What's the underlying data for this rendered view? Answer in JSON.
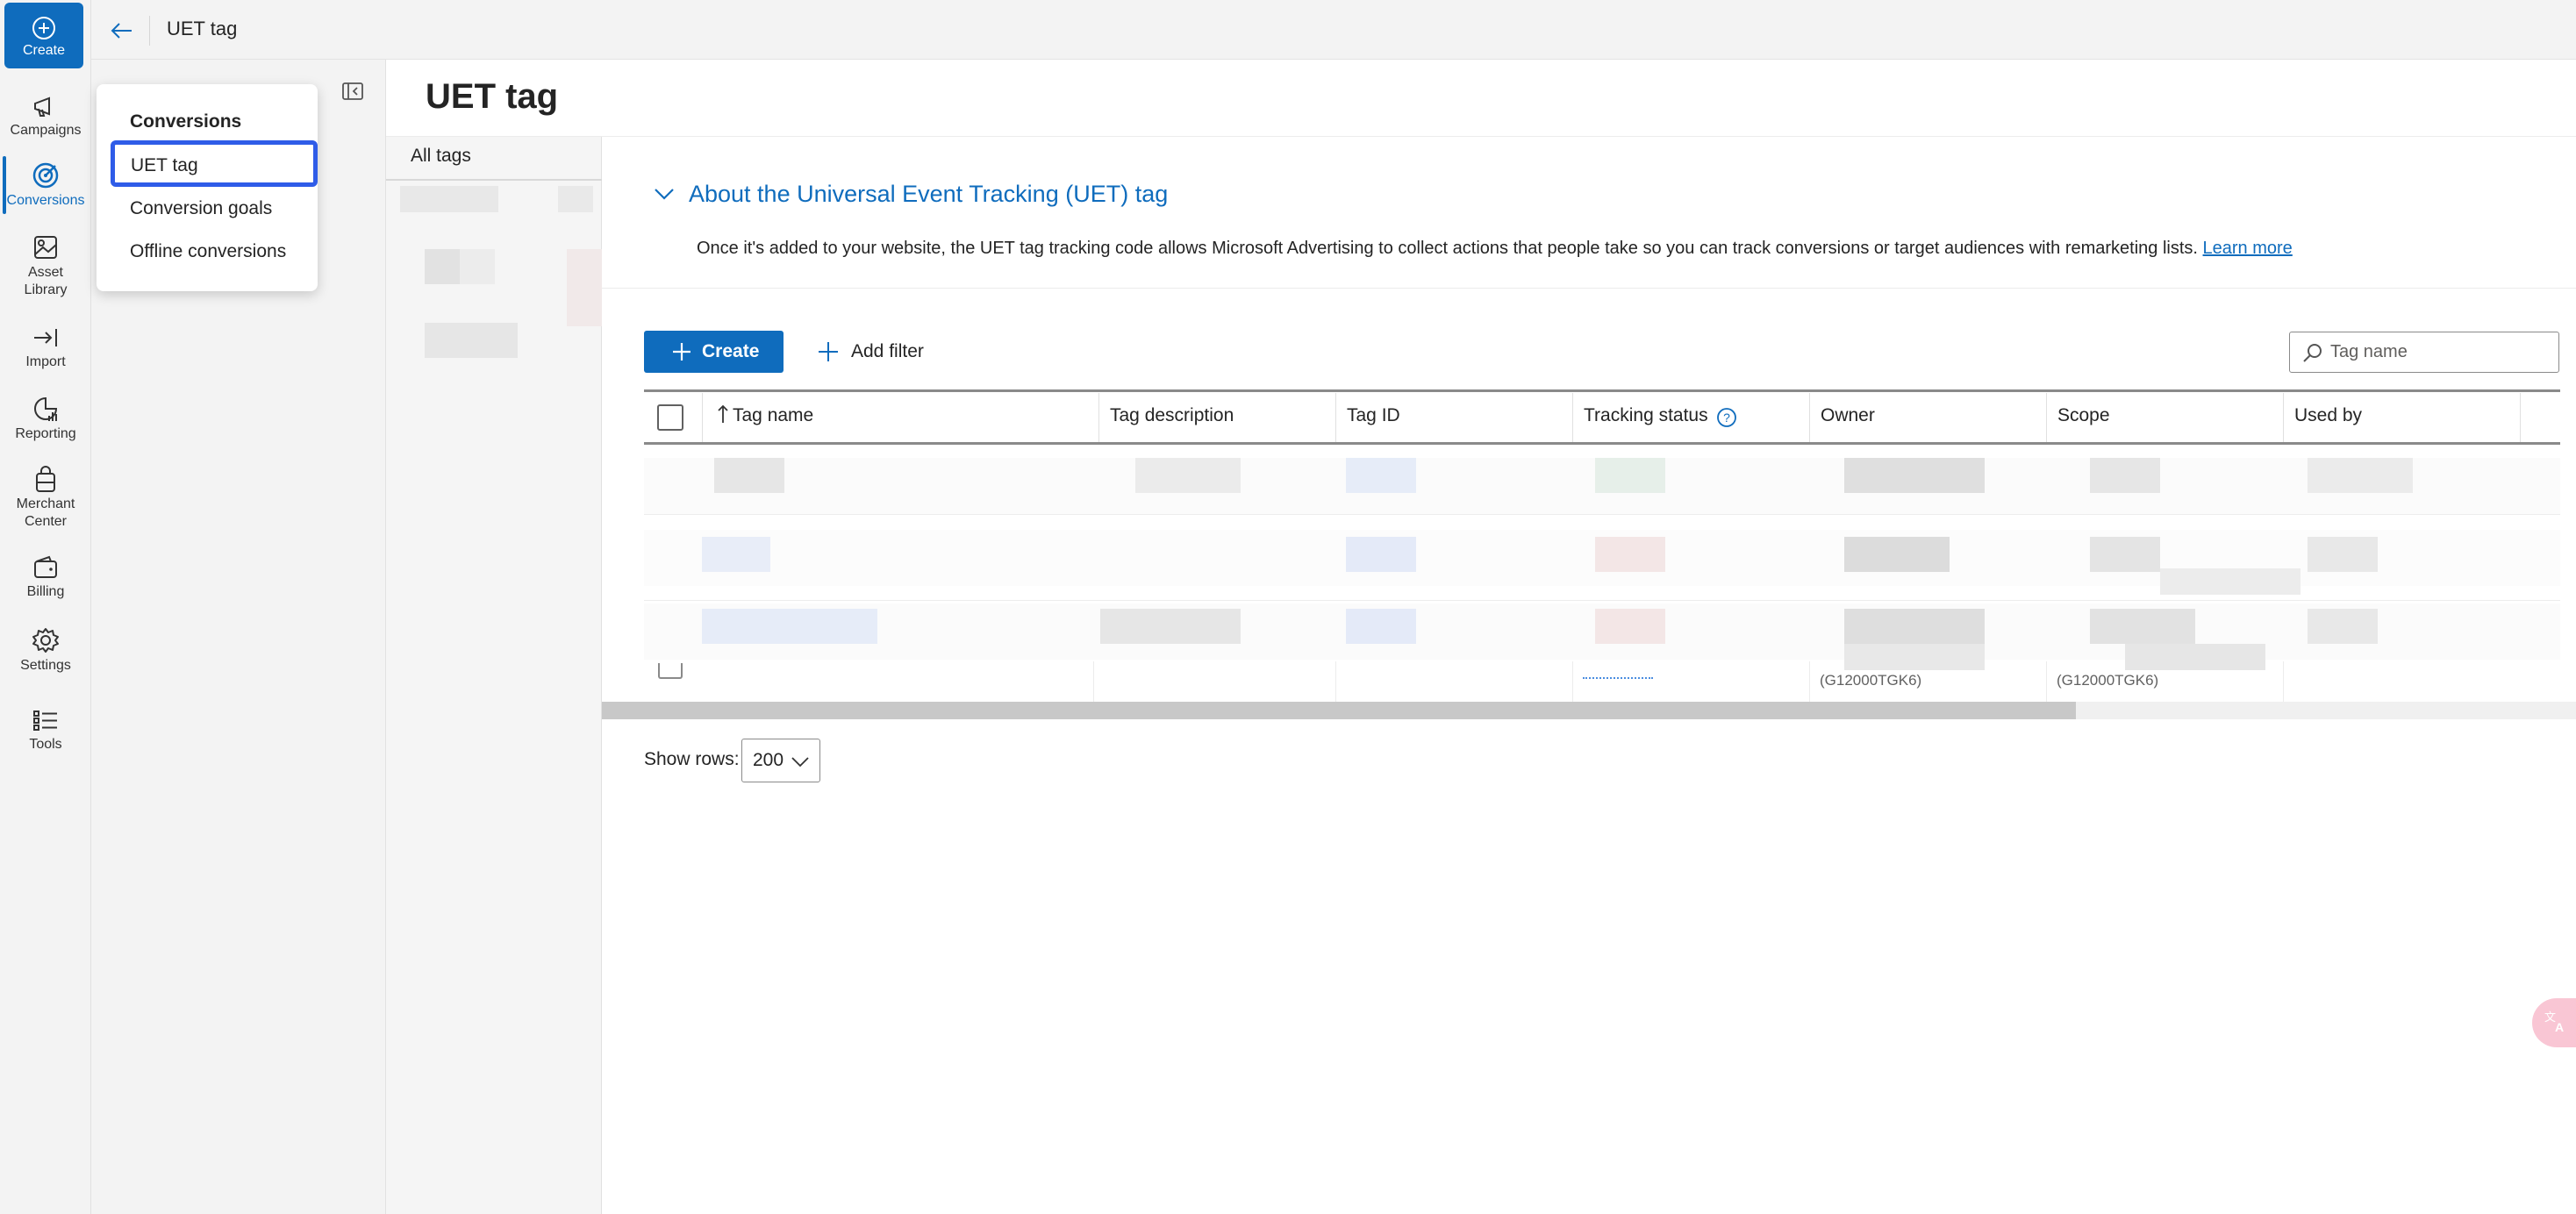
{
  "rail": {
    "create_label": "Create",
    "items": [
      {
        "label": "Campaigns",
        "icon": "megaphone-icon"
      },
      {
        "label": "Conversions",
        "icon": "target-icon",
        "active": true
      },
      {
        "label": "Asset Library",
        "icon": "asset-library-icon"
      },
      {
        "label": "Import",
        "icon": "import-icon"
      },
      {
        "label": "Reporting",
        "icon": "reporting-icon"
      },
      {
        "label": "Merchant Center",
        "icon": "shopping-bag-icon"
      },
      {
        "label": "Billing",
        "icon": "wallet-icon"
      },
      {
        "label": "Settings",
        "icon": "gear-icon"
      },
      {
        "label": "Tools",
        "icon": "tools-list-icon"
      }
    ]
  },
  "topbar": {
    "title": "UET tag"
  },
  "flyout": {
    "heading": "Conversions",
    "items": [
      "UET tag",
      "Conversion goals",
      "Offline conversions"
    ],
    "selected": "UET tag"
  },
  "page": {
    "title": "UET tag"
  },
  "tags_panel": {
    "all_tags_label": "All tags"
  },
  "about": {
    "title": "About the Universal Event Tracking (UET) tag",
    "description": "Once it's added to your website, the UET tag tracking code allows Microsoft Advertising to collect actions that people take so you can track conversions or target audiences with remarketing lists.",
    "learn_more": "Learn more"
  },
  "toolbar": {
    "create_label": "Create",
    "add_filter_label": "Add filter",
    "search_placeholder": "Tag name"
  },
  "table": {
    "columns": [
      "Tag name",
      "Tag description",
      "Tag ID",
      "Tracking status",
      "Owner",
      "Scope",
      "Used by"
    ],
    "sort_column": "Tag name",
    "partial_row": {
      "owner": "(G12000TGK6)",
      "scope": "(G12000TGK6)"
    }
  },
  "pagination": {
    "show_rows_label": "Show rows:",
    "show_rows_value": "200"
  },
  "colors": {
    "accent": "#0f6cbd",
    "focus_ring": "#2f5ce8",
    "badge": "#f9c6d4"
  }
}
